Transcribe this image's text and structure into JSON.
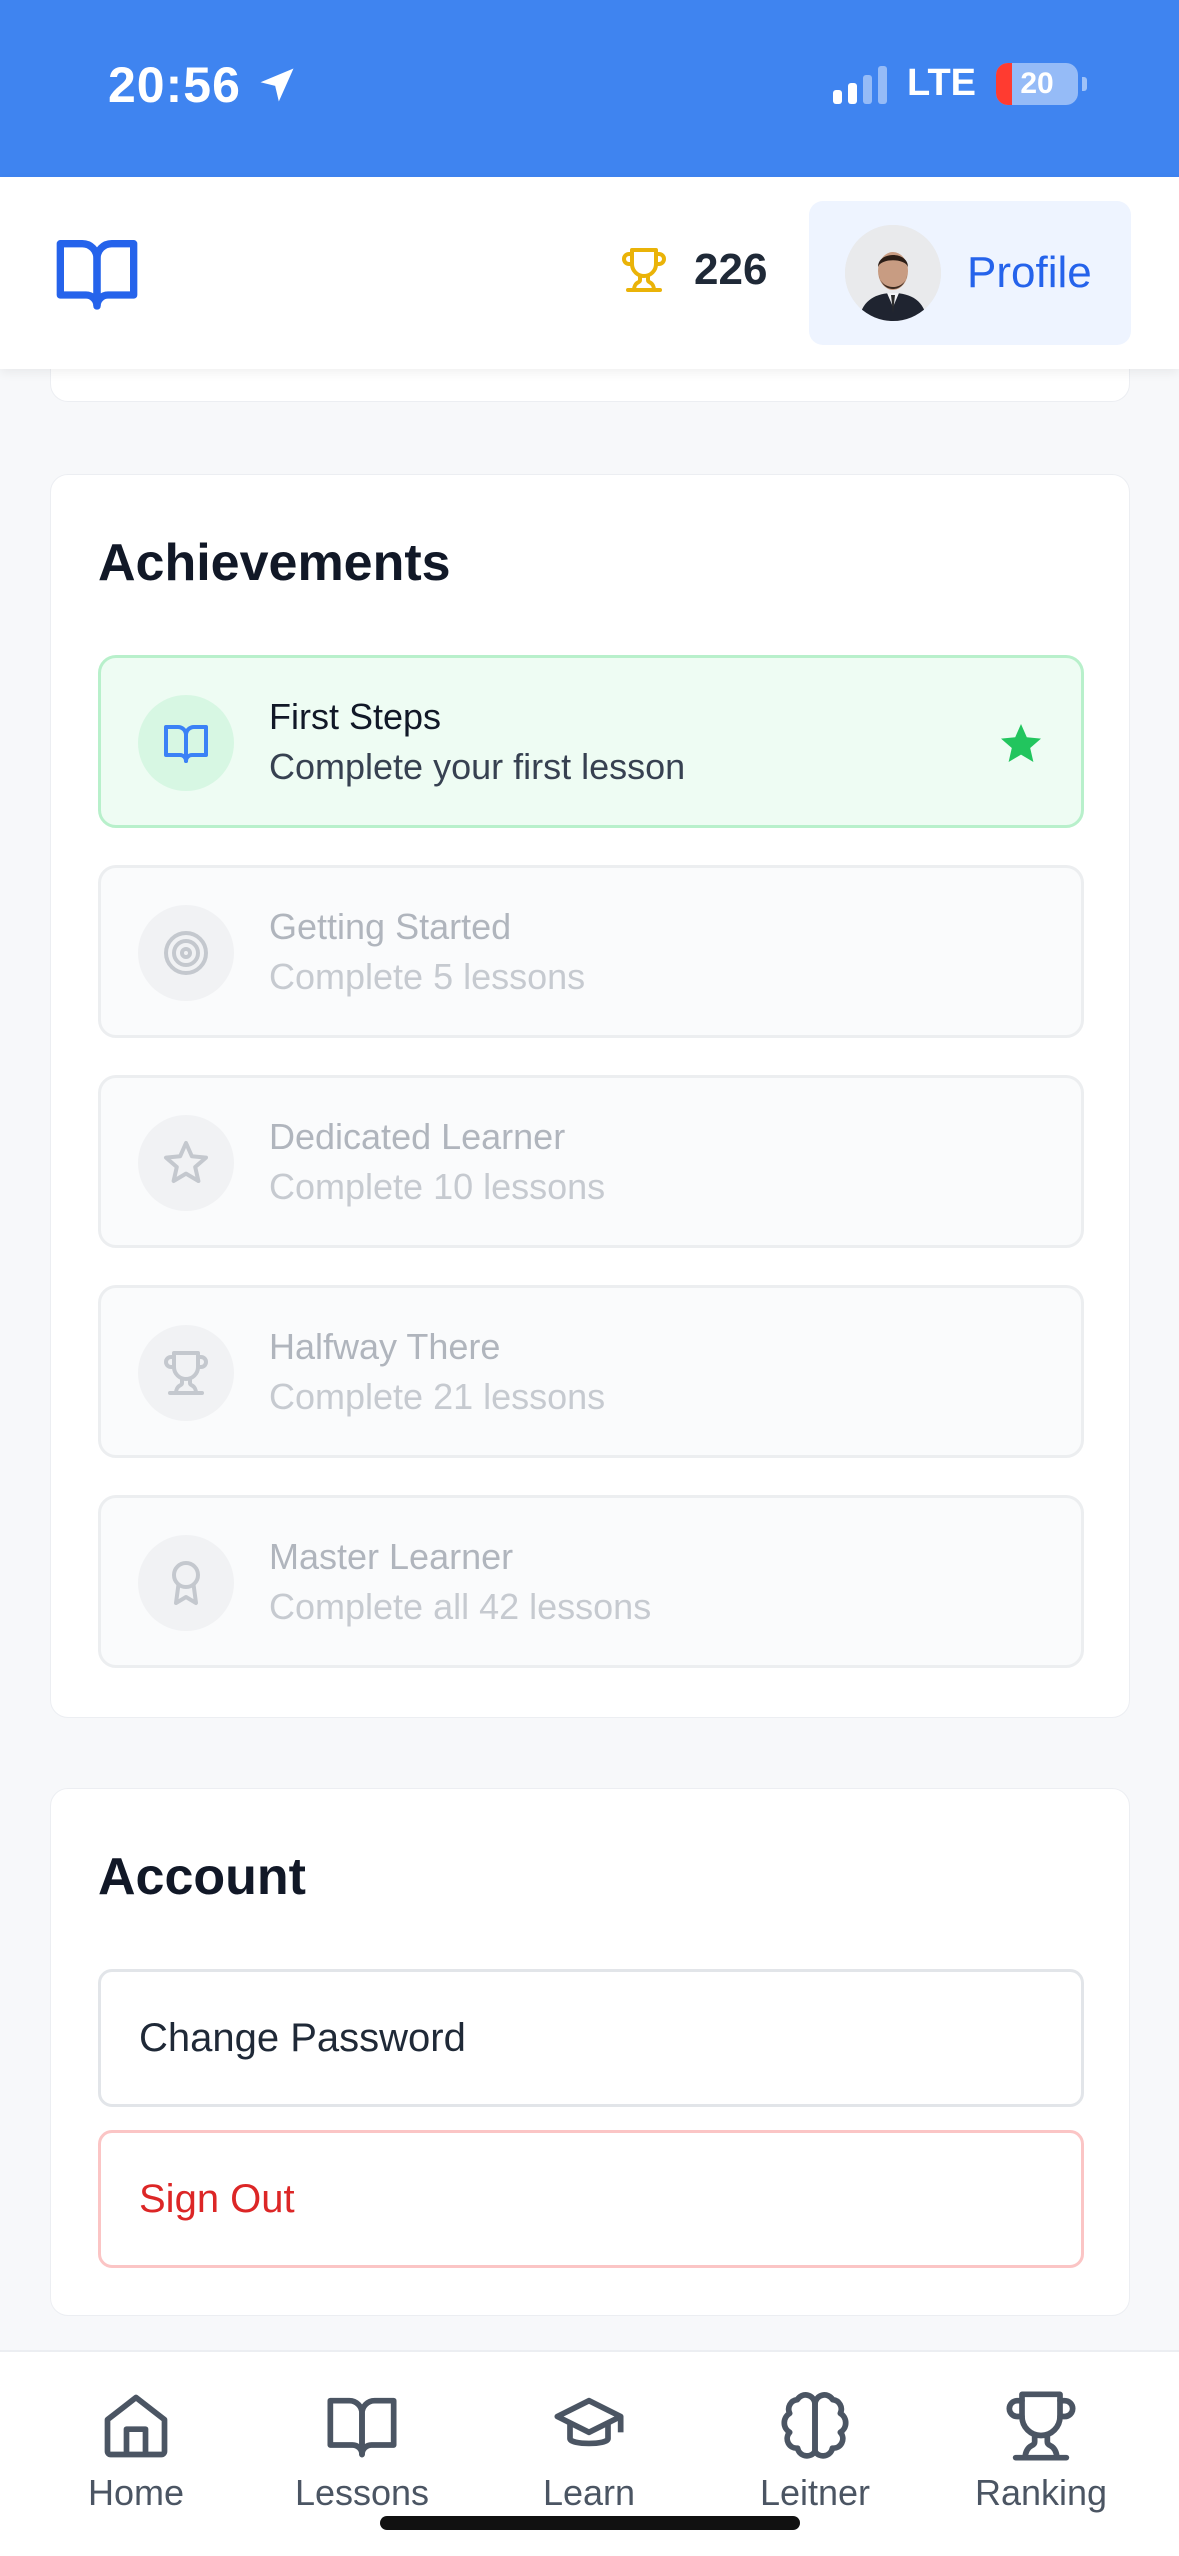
{
  "status_bar": {
    "time": "20:56",
    "network": "LTE",
    "battery": "20",
    "battery_percent": 20,
    "location_icon": "location-arrow-icon",
    "signal_icon": "signal-bars-icon"
  },
  "header": {
    "logo_icon": "book-open-icon",
    "points_icon": "trophy-icon",
    "points": "226",
    "profile_label": "Profile"
  },
  "achievements": {
    "title": "Achievements",
    "items": [
      {
        "title": "First Steps",
        "description": "Complete your first lesson",
        "icon": "book-open-icon",
        "unlocked": true
      },
      {
        "title": "Getting Started",
        "description": "Complete 5 lessons",
        "icon": "target-icon",
        "unlocked": false
      },
      {
        "title": "Dedicated Learner",
        "description": "Complete 10 lessons",
        "icon": "star-icon",
        "unlocked": false
      },
      {
        "title": "Halfway There",
        "description": "Complete 21 lessons",
        "icon": "trophy-icon",
        "unlocked": false
      },
      {
        "title": "Master Learner",
        "description": "Complete all 42 lessons",
        "icon": "award-icon",
        "unlocked": false
      }
    ]
  },
  "account": {
    "title": "Account",
    "change_password": "Change Password",
    "sign_out": "Sign Out"
  },
  "bottom_nav": {
    "items": [
      {
        "label": "Home",
        "icon": "home-icon"
      },
      {
        "label": "Lessons",
        "icon": "book-open-icon"
      },
      {
        "label": "Learn",
        "icon": "graduation-cap-icon"
      },
      {
        "label": "Leitner",
        "icon": "brain-icon"
      },
      {
        "label": "Ranking",
        "icon": "trophy-icon"
      }
    ]
  },
  "colors": {
    "status_bar": "#3f84f0",
    "accent": "#2563eb",
    "trophy": "#eab308",
    "success": "#22c55e",
    "danger": "#dc2626"
  }
}
